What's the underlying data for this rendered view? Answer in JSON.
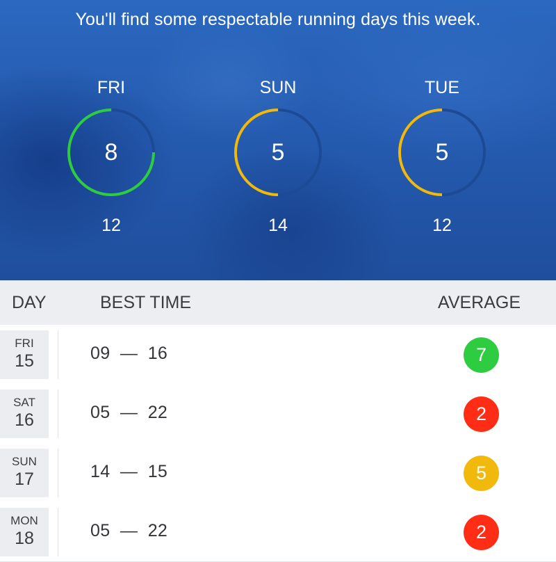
{
  "hero": {
    "headline": "You'll find some respectable running days this week.",
    "forecasts": [
      {
        "day": "FRI",
        "score": "8",
        "hours": "12",
        "fraction": 0.75,
        "color": "#2ecc40"
      },
      {
        "day": "SUN",
        "score": "5",
        "hours": "14",
        "fraction": 0.5,
        "color": "#f0b90b"
      },
      {
        "day": "TUE",
        "score": "5",
        "hours": "12",
        "fraction": 0.5,
        "color": "#f0b90b"
      }
    ]
  },
  "table": {
    "headers": {
      "day": "DAY",
      "best_time": "BEST TIME",
      "average": "AVERAGE"
    },
    "rows": [
      {
        "weekday": "FRI",
        "date": "15",
        "best_time": "09  —  16",
        "average": "7",
        "color": "#2ecc40"
      },
      {
        "weekday": "SAT",
        "date": "16",
        "best_time": "05  —  22",
        "average": "2",
        "color": "#ff2d16"
      },
      {
        "weekday": "SUN",
        "date": "17",
        "best_time": "14  —  15",
        "average": "5",
        "color": "#f0b90b"
      },
      {
        "weekday": "MON",
        "date": "18",
        "best_time": "05  —  22",
        "average": "2",
        "color": "#ff2d16"
      }
    ]
  },
  "colors": {
    "ring_track": "#1d4a95",
    "good": "#2ecc40",
    "bad": "#ff2d16",
    "ok": "#f0b90b"
  }
}
